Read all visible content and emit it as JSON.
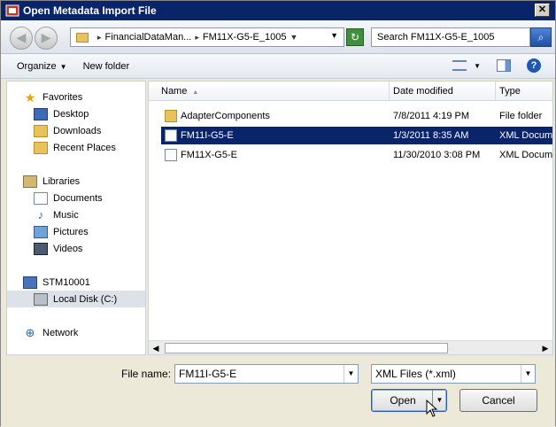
{
  "window": {
    "title": "Open Metadata Import File",
    "close_glyph": "✕"
  },
  "address": {
    "back_glyph": "◀",
    "forward_glyph": "▶",
    "crumbs": [
      "FinancialDataMan...",
      "FM11X-G5-E_1005"
    ],
    "crumb_sep": "▸",
    "dropdown_glyph": "▼",
    "refresh_glyph": "↻",
    "search_placeholder": "Search FM11X-G5-E_1005",
    "search_glyph": "⌕"
  },
  "toolbar": {
    "organize_label": "Organize",
    "organize_arrow": "▼",
    "new_folder_label": "New folder",
    "view_arrow": "▼",
    "help_glyph": "?"
  },
  "nav": {
    "favorites_label": "Favorites",
    "desktop_label": "Desktop",
    "downloads_label": "Downloads",
    "recent_label": "Recent Places",
    "libraries_label": "Libraries",
    "documents_label": "Documents",
    "music_label": "Music",
    "pictures_label": "Pictures",
    "videos_label": "Videos",
    "computer_label": "STM10001",
    "localdisk_label": "Local Disk (C:)",
    "network_label": "Network",
    "star_glyph": "★",
    "music_glyph": "♪",
    "network_glyph": "⊕"
  },
  "files": {
    "col_name": "Name",
    "col_sort_glyph": "▲",
    "col_date": "Date modified",
    "col_type": "Type",
    "rows": [
      {
        "name": "AdapterComponents",
        "date": "7/8/2011 4:19 PM",
        "type": "File folder"
      },
      {
        "name": "FM11I-G5-E",
        "date": "1/3/2011 8:35 AM",
        "type": "XML Document"
      },
      {
        "name": "FM11X-G5-E",
        "date": "11/30/2010 3:08 PM",
        "type": "XML Document"
      }
    ],
    "scroll_left_glyph": "◀",
    "scroll_right_glyph": "▶"
  },
  "bottom": {
    "file_name_label": "File name:",
    "file_name_value": "FM11I-G5-E",
    "filter_value": "XML Files (*.xml)",
    "dropdown_glyph": "▼",
    "open_label": "Open",
    "cancel_label": "Cancel"
  }
}
